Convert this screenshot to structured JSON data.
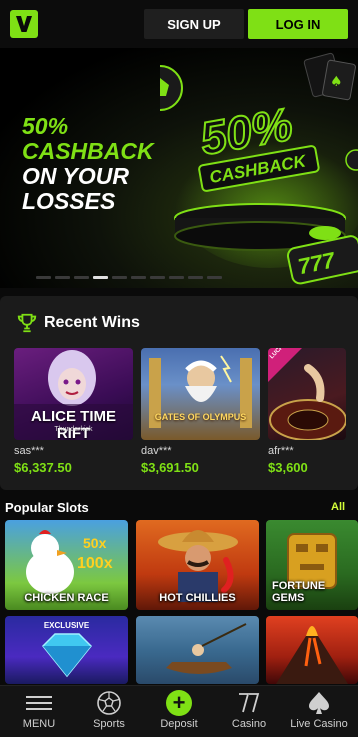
{
  "header": {
    "logo_letter": "V",
    "signup_label": "SIGN UP",
    "login_label": "LOG IN"
  },
  "hero": {
    "line1": "50%",
    "line2": "CASHBACK",
    "line3": "ON YOUR",
    "line4": "LOSSES",
    "badge_percent": "50%",
    "badge_word": "CASHBACK",
    "slide_count": 10,
    "active_slide": 3
  },
  "recent_wins": {
    "title": "Recent Wins",
    "items": [
      {
        "game": "ALICE TIME RIFT",
        "provider": "Thunderkick",
        "user": "sas***",
        "amount": "$6,337.50"
      },
      {
        "game": "GATES OF OLYMPUS",
        "user": "dav***",
        "amount": "$3,691.50"
      },
      {
        "game": "LUCKY STREAK",
        "user": "afr***",
        "amount": "$3,600"
      }
    ]
  },
  "popular": {
    "title": "Popular Slots",
    "all_label": "All",
    "slots": [
      {
        "label": "CHICKEN RACE",
        "badge": ""
      },
      {
        "label": "HOT CHILLIES",
        "badge": ""
      },
      {
        "label": "FORTUNE GEMS",
        "badge": ""
      },
      {
        "label": "",
        "badge": "EXCLUSIVE"
      },
      {
        "label": "",
        "badge": ""
      },
      {
        "label": "",
        "badge": ""
      }
    ]
  },
  "nav": {
    "items": [
      {
        "label": "MENU",
        "icon": "menu-icon"
      },
      {
        "label": "Sports",
        "icon": "soccer-ball-icon"
      },
      {
        "label": "Deposit",
        "icon": "plus-icon"
      },
      {
        "label": "Casino",
        "icon": "sevens-icon"
      },
      {
        "label": "Live Casino",
        "icon": "spade-icon"
      }
    ]
  },
  "colors": {
    "accent": "#7fe015",
    "background": "#0a0a0a",
    "panel": "#1b1b1b",
    "all_link": "#d4ff3a"
  }
}
